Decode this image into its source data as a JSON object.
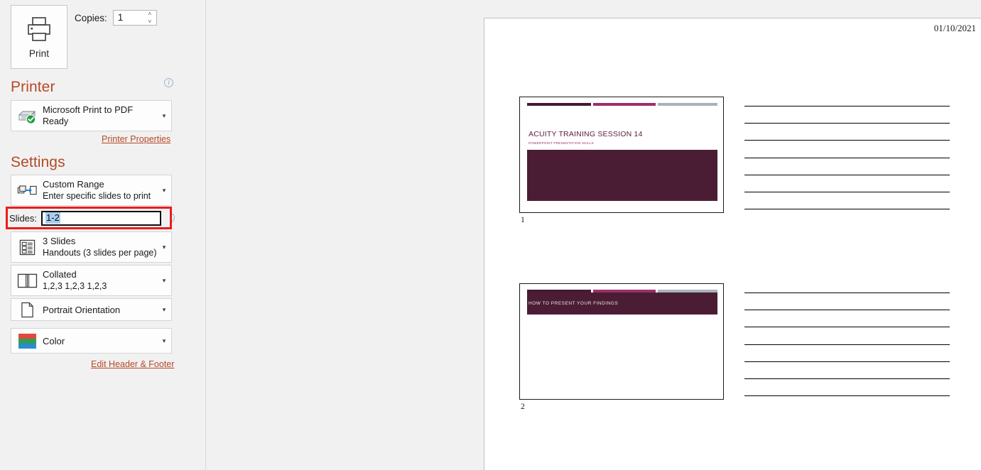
{
  "app": {
    "screen": "print-backstage"
  },
  "print": {
    "button_label": "Print",
    "icon": "printer-icon",
    "copies_label": "Copies:",
    "copies_value": "1",
    "spin_up": "˄",
    "spin_down": "˅"
  },
  "printer": {
    "heading": "Printer",
    "info_glyph": "i",
    "name": "Microsoft Print to PDF",
    "status": "Ready",
    "icon": "printer-ready-icon",
    "caret": "▾",
    "properties_link": "Printer Properties"
  },
  "settings": {
    "heading": "Settings",
    "caret": "▾",
    "range": {
      "icon": "print-range-icon",
      "primary": "Custom Range",
      "secondary": "Enter specific slides to print"
    },
    "slides": {
      "label": "Slides:",
      "value": "1-2",
      "placeholder": "",
      "info_glyph": "i"
    },
    "layout": {
      "icon": "handout-layout-icon",
      "primary": "3 Slides",
      "secondary": "Handouts (3 slides per page)"
    },
    "collation": {
      "icon": "collated-icon",
      "primary": "Collated",
      "secondary": "1,2,3   1,2,3   1,2,3"
    },
    "orientation": {
      "icon": "portrait-page-icon",
      "primary": "Portrait Orientation"
    },
    "color": {
      "icon": "color-swatch-icon",
      "primary": "Color"
    },
    "edit_header_footer_link": "Edit Header & Footer"
  },
  "preview": {
    "date": "01/10/2021",
    "note_line_count": 7,
    "slides": [
      {
        "number": "1",
        "title": "ACUITY TRAINING SESSION 14",
        "subtitle": "POWERPOINT PRESENTATION SKILLS",
        "layout": "title-slide"
      },
      {
        "number": "2",
        "title": "HOW TO PRESENT YOUR FINDINGS",
        "subtitle": "",
        "layout": "section-header"
      }
    ]
  },
  "colors": {
    "accent_heading": "#b64926",
    "highlight_box": "#ee1c1c",
    "selection": "#a8cdee",
    "slide_dark": "#4b1d34",
    "slide_magenta": "#9c2f69",
    "slide_gray": "#a8b3b9",
    "panel_bg": "#f1f1f1"
  }
}
